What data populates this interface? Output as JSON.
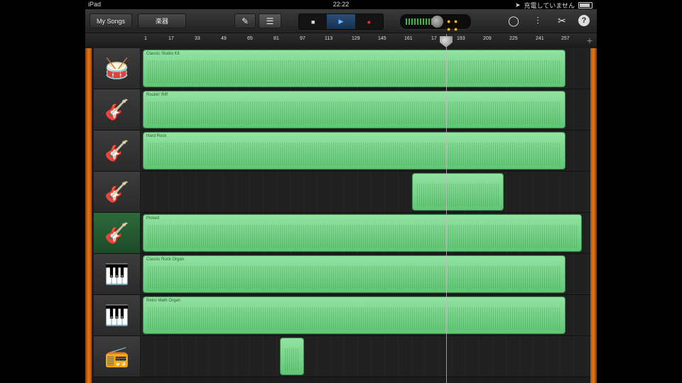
{
  "status_bar": {
    "device": "iPad",
    "time": "22:22",
    "charging_text": "充電していません"
  },
  "toolbar": {
    "my_songs": "My Songs",
    "instruments": "楽器",
    "icons": [
      "guitar-icon",
      "tracks-view-icon",
      "stop-icon",
      "play-icon",
      "record-icon",
      "loop-browser-icon",
      "mixer-icon",
      "settings-wrench-icon",
      "help-icon"
    ],
    "help_label": "?"
  },
  "ruler": {
    "ticks": [
      "1",
      "17",
      "33",
      "49",
      "65",
      "81",
      "97",
      "113",
      "129",
      "145",
      "161",
      "17",
      "193",
      "209",
      "225",
      "241",
      "257"
    ],
    "playhead_bar": 177
  },
  "tracks": [
    {
      "instrument": "drums-icon",
      "region_name": "Classic Studio Kit",
      "selected": false
    },
    {
      "instrument": "electric-guitar-icon",
      "region_name": "Rockin' Riff",
      "selected": false
    },
    {
      "instrument": "electric-guitar-icon",
      "region_name": "Hard Rock",
      "selected": false
    },
    {
      "instrument": "electric-guitar-icon",
      "region_name": "",
      "selected": false
    },
    {
      "instrument": "bass-guitar-icon",
      "region_name": "Picked",
      "selected": true
    },
    {
      "instrument": "organ-icon",
      "region_name": "Classic Rock Organ",
      "selected": false
    },
    {
      "instrument": "organ-icon",
      "region_name": "Retro Math Organ",
      "selected": false
    },
    {
      "instrument": "amp-icon",
      "region_name": "",
      "selected": false
    }
  ],
  "colors": {
    "region_green": "#6fd184",
    "accent_orange": "#e3781e",
    "play_blue": "#2a4f7a"
  }
}
